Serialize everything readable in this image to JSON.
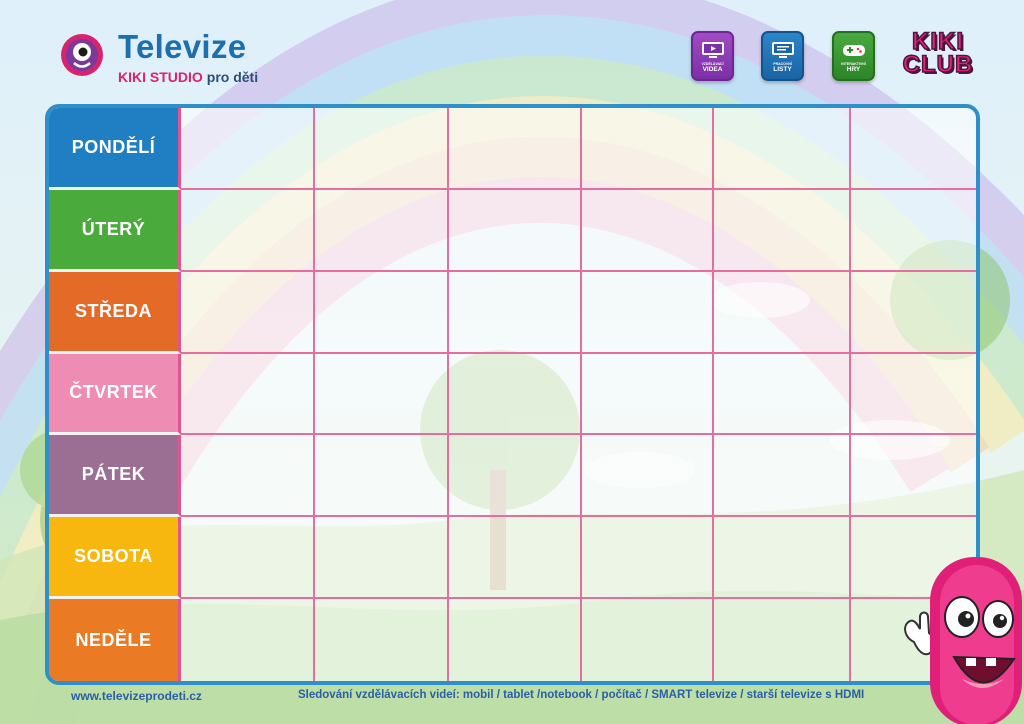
{
  "brand": {
    "title": "Televize",
    "studio": "KIKI STUDIO",
    "subtitle": "pro děti"
  },
  "header_links": [
    {
      "small": "vzdělávací",
      "big": "VIDEA",
      "icon": "video-screen-icon"
    },
    {
      "small": "pracovní",
      "big": "LISTY",
      "icon": "worksheet-screen-icon"
    },
    {
      "small": "interaktivní",
      "big": "HRY",
      "icon": "gamepad-icon"
    }
  ],
  "club": {
    "line1": "KIKI",
    "line2": "CLUB"
  },
  "schedule": {
    "days": [
      {
        "label": "PONDĚLÍ",
        "color": "#1f7fc2"
      },
      {
        "label": "ÚTERÝ",
        "color": "#4aaa3c"
      },
      {
        "label": "STŘEDA",
        "color": "#e46a28"
      },
      {
        "label": "ČTVRTEK",
        "color": "#ef8cb4"
      },
      {
        "label": "PÁTEK",
        "color": "#9a6f93"
      },
      {
        "label": "SOBOTA",
        "color": "#f7b70f"
      },
      {
        "label": "NEDĚLE",
        "color": "#ea7a24"
      }
    ],
    "slots_per_day": 6,
    "grid_line_color": "#e36ea0",
    "frame_color": "#2f8fc9"
  },
  "footer": {
    "url": "www.televizeprodeti.cz",
    "note": "Sledování  vzdělávacích videí: mobil / tablet /notebook / počítač / SMART televize / starší televize s HDMI"
  }
}
